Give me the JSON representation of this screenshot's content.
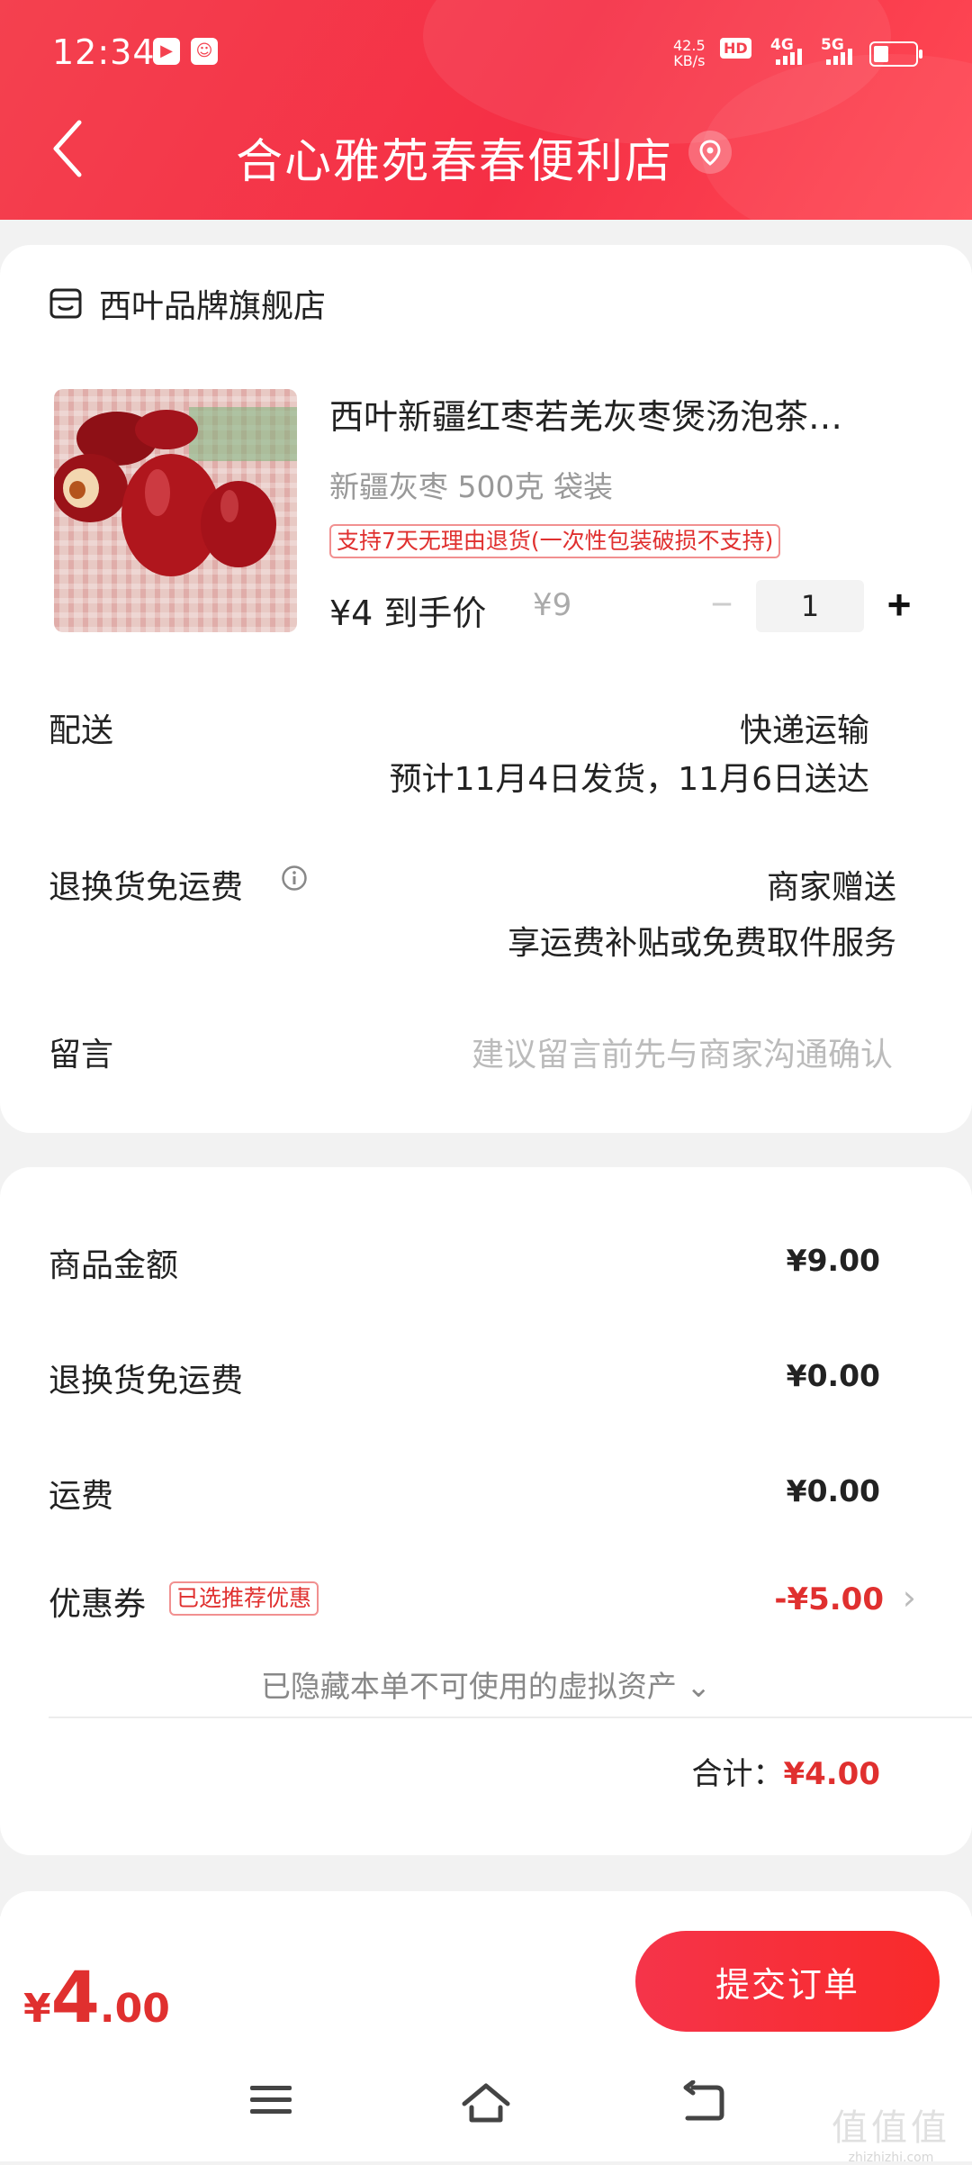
{
  "status_bar": {
    "time": "12:34",
    "net_speed": "42.5",
    "net_unit": "KB/s",
    "hd": "HD",
    "sig1": "4G",
    "sig2": "5G"
  },
  "header": {
    "title": "合心雅苑春春便利店"
  },
  "store": {
    "name": "西叶品牌旗舰店"
  },
  "product": {
    "title": "西叶新疆红枣若羌灰枣煲汤泡茶…",
    "spec": "新疆灰枣 500克 袋装",
    "tag": "支持7天无理由退货(一次性包装破损不支持)",
    "price": "¥4",
    "price_label": "到手价",
    "orig_price": "¥9",
    "quantity": "1",
    "minus": "−",
    "plus": "+"
  },
  "delivery": {
    "label": "配送",
    "method": "快递运输",
    "estimate": "预计11月4日发货，11月6日送达"
  },
  "return_shipping": {
    "label": "退换货免运费",
    "value": "商家赠送",
    "desc": "享运费补贴或免费取件服务"
  },
  "message": {
    "label": "留言",
    "placeholder": "建议留言前先与商家沟通确认"
  },
  "summary": {
    "goods_label": "商品金额",
    "goods_value": "¥9.00",
    "return_label": "退换货免运费",
    "return_value": "¥0.00",
    "shipping_label": "运费",
    "shipping_value": "¥0.00",
    "coupon_label": "优惠券",
    "coupon_tag": "已选推荐优惠",
    "coupon_value": "-¥5.00",
    "hidden_note": "已隐藏本单不可使用的虚拟资产 ⌄",
    "total_label": "合计：",
    "total_value": "¥4.00"
  },
  "bottom_bar": {
    "currency": "¥",
    "price_int": "4",
    "price_dec": ".00",
    "submit_label": "提交订单"
  },
  "watermark": {
    "main": "值值值",
    "sub": "zhizhizhi.com"
  },
  "colors": {
    "brand_red": "#f4414f",
    "price_red": "#e0302f"
  }
}
